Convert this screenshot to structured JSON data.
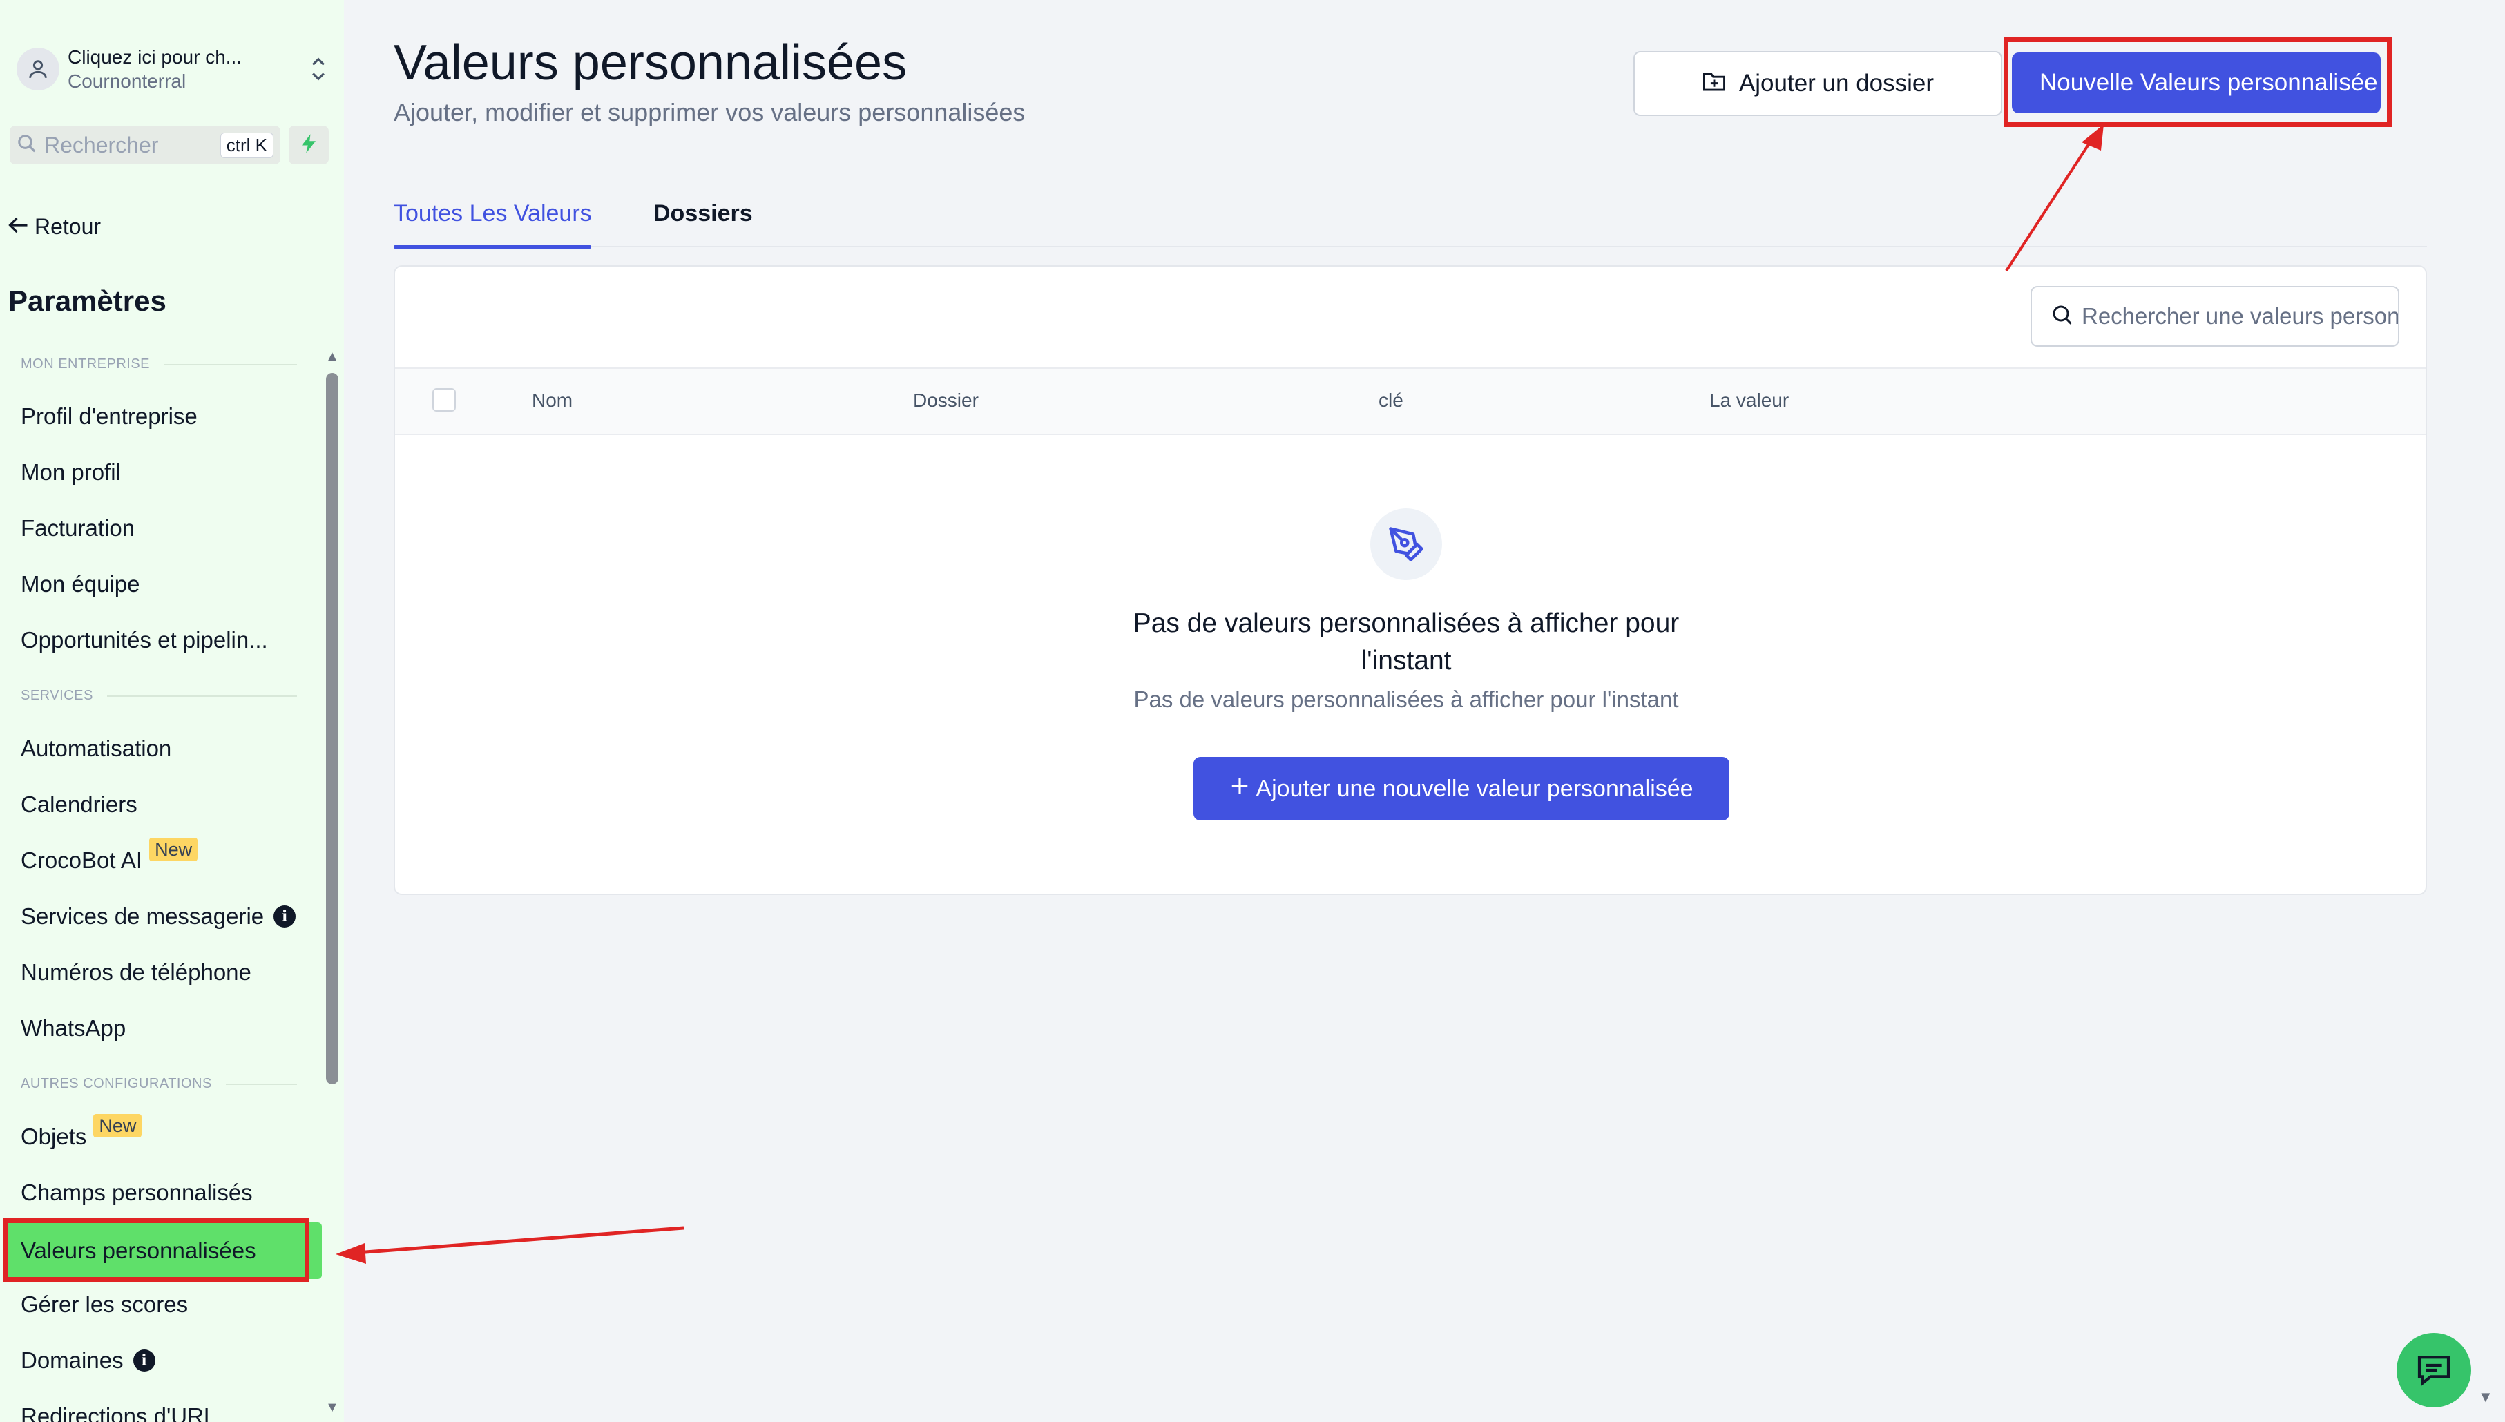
{
  "account": {
    "title": "Cliquez ici pour ch...",
    "subtitle": "Cournonterral"
  },
  "sidebar_search": {
    "placeholder": "Rechercher",
    "shortcut": "ctrl K"
  },
  "back_label": "Retour",
  "settings_title": "Paramètres",
  "sections": {
    "enterprise": "MON ENTREPRISE",
    "services": "SERVICES",
    "other": "AUTRES CONFIGURATIONS"
  },
  "nav_items": [
    {
      "label": "Profil d'entreprise"
    },
    {
      "label": "Mon profil"
    },
    {
      "label": "Facturation"
    },
    {
      "label": "Mon équipe"
    },
    {
      "label": "Opportunités et pipelin..."
    },
    {
      "label": "Automatisation"
    },
    {
      "label": "Calendriers"
    },
    {
      "label": "CrocoBot AI",
      "badge": "New"
    },
    {
      "label": "Services de messagerie",
      "info": "i"
    },
    {
      "label": "Numéros de téléphone"
    },
    {
      "label": "WhatsApp"
    },
    {
      "label": "Objets",
      "badge": "New"
    },
    {
      "label": "Champs personnalisés"
    },
    {
      "label": "Valeurs personnalisées",
      "active": true
    },
    {
      "label": "Gérer les scores"
    },
    {
      "label": "Domaines",
      "info": "i"
    },
    {
      "label": "Redirections d'URL"
    }
  ],
  "header": {
    "title": "Valeurs personnalisées",
    "subtitle": "Ajouter, modifier et supprimer vos valeurs personnalisées",
    "add_folder_label": "Ajouter un dossier",
    "new_value_label": "Nouvelle Valeurs personnalisée"
  },
  "tabs": [
    {
      "label": "Toutes Les Valeurs",
      "active": true
    },
    {
      "label": "Dossiers"
    }
  ],
  "table": {
    "search_placeholder": "Rechercher une valeurs personnalisée",
    "columns": [
      "Nom",
      "Dossier",
      "clé",
      "La valeur"
    ],
    "rows": []
  },
  "empty_state": {
    "title": "Pas de valeurs personnalisées à afficher pour l'instant",
    "subtitle": "Pas de valeurs personnalisées à afficher pour l'instant",
    "button_label": "Ajouter une nouvelle valeur personnalisée"
  },
  "colors": {
    "accent": "#4152e0",
    "sidebar_bg": "#effdf0",
    "active_item": "#5fe06a",
    "annotation": "#e02424",
    "badge": "#fdd663"
  },
  "icons": [
    "user-circle-icon",
    "chevron-updown-icon",
    "search-icon",
    "bolt-icon",
    "arrow-left-icon",
    "info-icon",
    "folder-plus-icon",
    "pen-nib-icon",
    "plus-icon",
    "chat-icon"
  ]
}
